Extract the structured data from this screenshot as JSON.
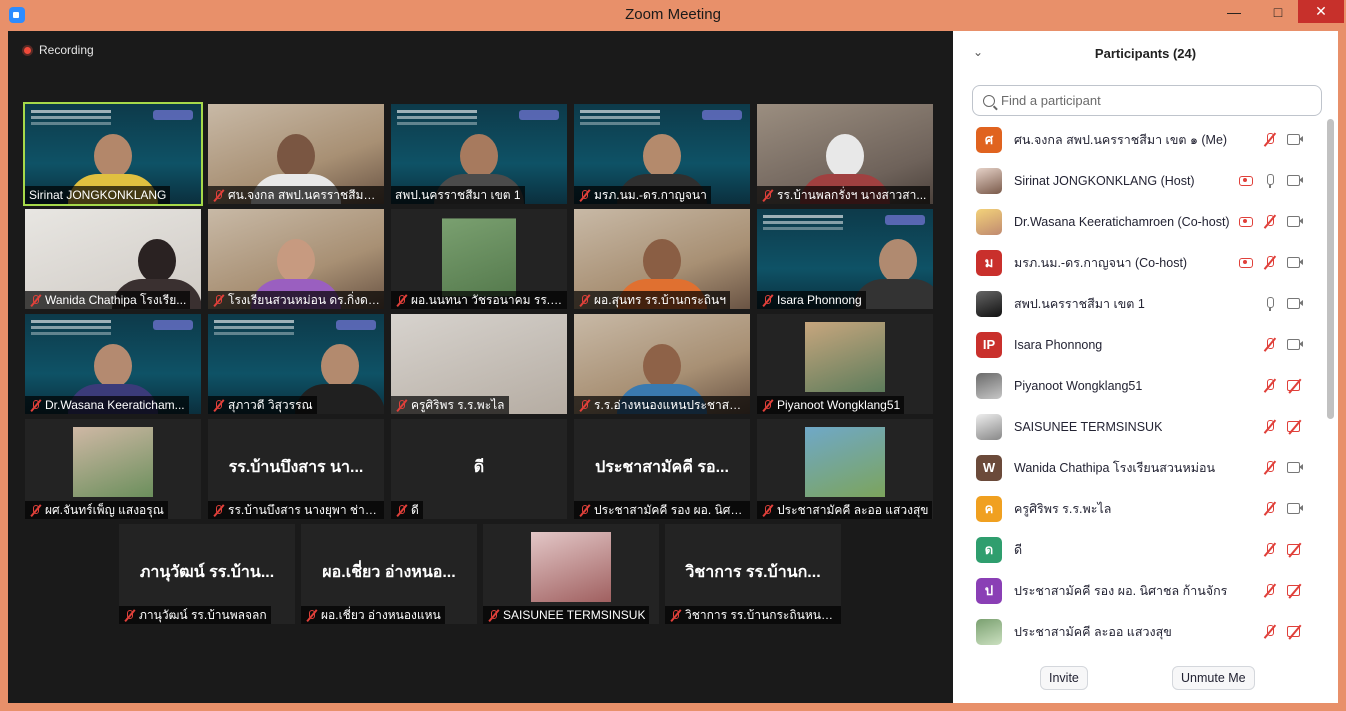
{
  "window": {
    "title": "Zoom Meeting"
  },
  "recording": {
    "label": "Recording"
  },
  "tiles": [
    {
      "name": "Sirinat JONGKONKLANG",
      "muted": false
    },
    {
      "name": "ศน.จงกล สพป.นครราชสีมา เ...",
      "muted": true
    },
    {
      "name": "สพป.นครราชสีมา เขต 1",
      "muted": false
    },
    {
      "name": "มรภ.นม.-ดร.กาญจนา",
      "muted": true
    },
    {
      "name": "รร.บ้านพลกรั่งฯ  นางสาวสา...",
      "muted": true
    },
    {
      "name": "Wanida Chathipa โรงเรีย...",
      "muted": true
    },
    {
      "name": "โรงเรียนสวนหม่อน ดร.กิ่งดาว",
      "muted": true
    },
    {
      "name": "ผอ.นนทนา วัชรอนาคม รร.บ้...",
      "muted": true
    },
    {
      "name": "ผอ.สุนทร รร.บ้านกระถินฯ",
      "muted": true
    },
    {
      "name": "Isara Phonnong",
      "muted": true
    },
    {
      "name": "Dr.Wasana Keeraticham...",
      "muted": true
    },
    {
      "name": "สุภาวดี วิสุวรรณ",
      "muted": true
    },
    {
      "name": "ครูศิริพร ร.ร.พะไล",
      "muted": true
    },
    {
      "name": "ร.ร.อ่างหนองแหนประชาสามัคคี",
      "muted": true
    },
    {
      "name": "Piyanoot Wongklang51",
      "muted": true
    },
    {
      "name": "ผศ.จันทร์เพ็ญ แสงอรุณ",
      "muted": true
    },
    {
      "name": "รร.บ้านบึงสาร นางยุพา  ช่าง...",
      "big": "รร.บ้านบึงสาร นา...",
      "muted": true
    },
    {
      "name": "ดี",
      "big": "ดี",
      "muted": true
    },
    {
      "name": "ประชาสามัคคี  รอง ผอ. นิศา...",
      "big": "ประชาสามัคคี รอ...",
      "muted": true
    },
    {
      "name": "ประชาสามัคคี ละออ แสวงสุข",
      "muted": true
    },
    {
      "name": "ภานุวัฒน์ รร.บ้านพลจลก",
      "big": "ภานุวัฒน์ รร.บ้าน...",
      "muted": true
    },
    {
      "name": "ผอ.เชี่ยว อ่างหนองแหน",
      "big": "ผอ.เชี่ยว อ่างหนอ...",
      "muted": true
    },
    {
      "name": "SAISUNEE TERMSINSUK",
      "muted": true
    },
    {
      "name": "วิชาการ รร.บ้านกระถินหนองแ...",
      "big": "วิชาการ รร.บ้านก...",
      "muted": true
    }
  ],
  "panel": {
    "title": "Participants (24)",
    "search_placeholder": "Find a participant",
    "participants": [
      {
        "name": "ศน.จงกล สพป.นครราชสีมา เขต ๑ (Me)",
        "initial": "ศ",
        "color": "#e0631f",
        "rec": false,
        "mic": "off",
        "cam": "on"
      },
      {
        "name": "Sirinat JONGKONKLANG (Host)",
        "initial": "",
        "color": "",
        "rec": true,
        "mic": "on",
        "cam": "on"
      },
      {
        "name": "Dr.Wasana Keeratichamroen (Co-host)",
        "initial": "",
        "color": "",
        "rec": true,
        "mic": "off",
        "cam": "on"
      },
      {
        "name": "มรภ.นม.-ดร.กาญจนา (Co-host)",
        "initial": "ม",
        "color": "#c9302c",
        "rec": true,
        "mic": "off",
        "cam": "on"
      },
      {
        "name": "สพป.นครราชสีมา เขต 1",
        "initial": "",
        "color": "",
        "rec": false,
        "mic": "on",
        "cam": "on"
      },
      {
        "name": "Isara Phonnong",
        "initial": "IP",
        "color": "#c9302c",
        "rec": false,
        "mic": "off",
        "cam": "on"
      },
      {
        "name": "Piyanoot Wongklang51",
        "initial": "",
        "color": "",
        "rec": false,
        "mic": "off",
        "cam": "off"
      },
      {
        "name": "SAISUNEE TERMSINSUK",
        "initial": "",
        "color": "",
        "rec": false,
        "mic": "off",
        "cam": "off"
      },
      {
        "name": "Wanida Chathipa โรงเรียนสวนหม่อน",
        "initial": "W",
        "color": "#6b4a3a",
        "rec": false,
        "mic": "off",
        "cam": "on"
      },
      {
        "name": "ครูศิริพร ร.ร.พะไล",
        "initial": "ค",
        "color": "#f0a020",
        "rec": false,
        "mic": "off",
        "cam": "on"
      },
      {
        "name": "ดี",
        "initial": "ด",
        "color": "#2f9e6e",
        "rec": false,
        "mic": "off",
        "cam": "off"
      },
      {
        "name": "ประชาสามัคคี  รอง ผอ. นิศาชล ก้านจักร",
        "initial": "ป",
        "color": "#8a3fb5",
        "rec": false,
        "mic": "off",
        "cam": "off"
      },
      {
        "name": "ประชาสามัคคี ละออ แสวงสุข",
        "initial": "",
        "color": "",
        "rec": false,
        "mic": "off",
        "cam": "off"
      }
    ],
    "invite_label": "Invite",
    "unmute_label": "Unmute Me"
  }
}
